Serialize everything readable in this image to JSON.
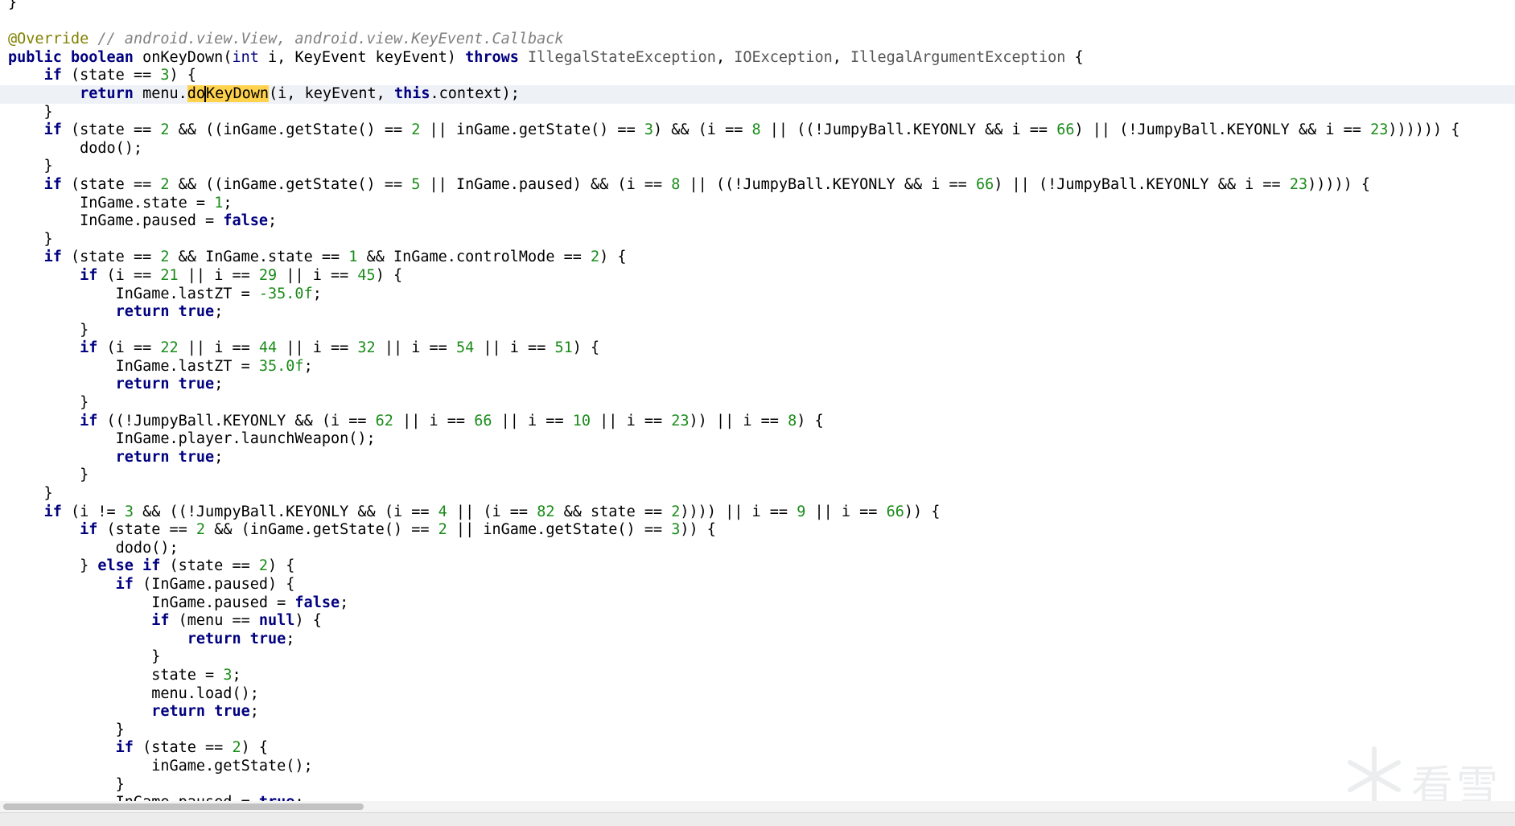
{
  "editor": {
    "language": "java",
    "cursor_line": 5,
    "highlighted_identifier": "doKeyDown",
    "watermark": "看雪",
    "lines": [
      [
        [
          "",
          "}"
        ]
      ],
      [],
      [
        [
          "ann",
          "@Override"
        ],
        [
          "cm",
          " // android.view.View, android.view.KeyEvent.Callback"
        ]
      ],
      [
        [
          "kw",
          "public"
        ],
        [
          "",
          " "
        ],
        [
          "kw",
          "boolean"
        ],
        [
          "",
          " onKeyDown("
        ],
        [
          "ty",
          "int"
        ],
        [
          "",
          " i, KeyEvent keyEvent) "
        ],
        [
          "kw",
          "throws"
        ],
        [
          "",
          " "
        ],
        [
          "exc",
          "IllegalStateException"
        ],
        [
          "",
          ", "
        ],
        [
          "exc",
          "IOException"
        ],
        [
          "",
          ", "
        ],
        [
          "exc",
          "IllegalArgumentException"
        ],
        [
          "",
          " {"
        ]
      ],
      [
        [
          "",
          "    "
        ],
        [
          "kw",
          "if"
        ],
        [
          "",
          " (state == "
        ],
        [
          "num",
          "3"
        ],
        [
          "",
          ") {"
        ]
      ],
      [
        [
          "",
          "        "
        ],
        [
          "kw",
          "return"
        ],
        [
          "",
          " menu."
        ],
        [
          "hl",
          "do"
        ],
        [
          "caret",
          ""
        ],
        [
          "hl",
          "KeyDown"
        ],
        [
          "",
          "(i, keyEvent, "
        ],
        [
          "kw",
          "this"
        ],
        [
          "",
          ".context);"
        ]
      ],
      [
        [
          "",
          "    }"
        ]
      ],
      [
        [
          "",
          "    "
        ],
        [
          "kw",
          "if"
        ],
        [
          "",
          " (state == "
        ],
        [
          "num",
          "2"
        ],
        [
          "",
          " && ((inGame.getState() == "
        ],
        [
          "num",
          "2"
        ],
        [
          "",
          " || inGame.getState() == "
        ],
        [
          "num",
          "3"
        ],
        [
          "",
          ") && (i == "
        ],
        [
          "num",
          "8"
        ],
        [
          "",
          " || ((!JumpyBall.KEYONLY && i == "
        ],
        [
          "num",
          "66"
        ],
        [
          "",
          ") || (!JumpyBall.KEYONLY && i == "
        ],
        [
          "num",
          "23"
        ],
        [
          "",
          ")))))) {"
        ]
      ],
      [
        [
          "",
          "        dodo();"
        ]
      ],
      [
        [
          "",
          "    }"
        ]
      ],
      [
        [
          "",
          "    "
        ],
        [
          "kw",
          "if"
        ],
        [
          "",
          " (state == "
        ],
        [
          "num",
          "2"
        ],
        [
          "",
          " && ((inGame.getState() == "
        ],
        [
          "num",
          "5"
        ],
        [
          "",
          " || InGame.paused) && (i == "
        ],
        [
          "num",
          "8"
        ],
        [
          "",
          " || ((!JumpyBall.KEYONLY && i == "
        ],
        [
          "num",
          "66"
        ],
        [
          "",
          ") || (!JumpyBall.KEYONLY && i == "
        ],
        [
          "num",
          "23"
        ],
        [
          "",
          "))))) {"
        ]
      ],
      [
        [
          "",
          "        InGame.state = "
        ],
        [
          "num",
          "1"
        ],
        [
          "",
          ";"
        ]
      ],
      [
        [
          "",
          "        InGame.paused = "
        ],
        [
          "kw",
          "false"
        ],
        [
          "",
          ";"
        ]
      ],
      [
        [
          "",
          "    }"
        ]
      ],
      [
        [
          "",
          "    "
        ],
        [
          "kw",
          "if"
        ],
        [
          "",
          " (state == "
        ],
        [
          "num",
          "2"
        ],
        [
          "",
          " && InGame.state == "
        ],
        [
          "num",
          "1"
        ],
        [
          "",
          " && InGame.controlMode == "
        ],
        [
          "num",
          "2"
        ],
        [
          "",
          ") {"
        ]
      ],
      [
        [
          "",
          "        "
        ],
        [
          "kw",
          "if"
        ],
        [
          "",
          " (i == "
        ],
        [
          "num",
          "21"
        ],
        [
          "",
          " || i == "
        ],
        [
          "num",
          "29"
        ],
        [
          "",
          " || i == "
        ],
        [
          "num",
          "45"
        ],
        [
          "",
          ") {"
        ]
      ],
      [
        [
          "",
          "            InGame.lastZT = "
        ],
        [
          "num",
          "-35.0f"
        ],
        [
          "",
          ";"
        ]
      ],
      [
        [
          "",
          "            "
        ],
        [
          "kw",
          "return"
        ],
        [
          "",
          " "
        ],
        [
          "kw",
          "true"
        ],
        [
          "",
          ";"
        ]
      ],
      [
        [
          "",
          "        }"
        ]
      ],
      [
        [
          "",
          "        "
        ],
        [
          "kw",
          "if"
        ],
        [
          "",
          " (i == "
        ],
        [
          "num",
          "22"
        ],
        [
          "",
          " || i == "
        ],
        [
          "num",
          "44"
        ],
        [
          "",
          " || i == "
        ],
        [
          "num",
          "32"
        ],
        [
          "",
          " || i == "
        ],
        [
          "num",
          "54"
        ],
        [
          "",
          " || i == "
        ],
        [
          "num",
          "51"
        ],
        [
          "",
          ") {"
        ]
      ],
      [
        [
          "",
          "            InGame.lastZT = "
        ],
        [
          "num",
          "35.0f"
        ],
        [
          "",
          ";"
        ]
      ],
      [
        [
          "",
          "            "
        ],
        [
          "kw",
          "return"
        ],
        [
          "",
          " "
        ],
        [
          "kw",
          "true"
        ],
        [
          "",
          ";"
        ]
      ],
      [
        [
          "",
          "        }"
        ]
      ],
      [
        [
          "",
          "        "
        ],
        [
          "kw",
          "if"
        ],
        [
          "",
          " ((!JumpyBall.KEYONLY && (i == "
        ],
        [
          "num",
          "62"
        ],
        [
          "",
          " || i == "
        ],
        [
          "num",
          "66"
        ],
        [
          "",
          " || i == "
        ],
        [
          "num",
          "10"
        ],
        [
          "",
          " || i == "
        ],
        [
          "num",
          "23"
        ],
        [
          "",
          ")) || i == "
        ],
        [
          "num",
          "8"
        ],
        [
          "",
          ") {"
        ]
      ],
      [
        [
          "",
          "            InGame.player.launchWeapon();"
        ]
      ],
      [
        [
          "",
          "            "
        ],
        [
          "kw",
          "return"
        ],
        [
          "",
          " "
        ],
        [
          "kw",
          "true"
        ],
        [
          "",
          ";"
        ]
      ],
      [
        [
          "",
          "        }"
        ]
      ],
      [
        [
          "",
          "    }"
        ]
      ],
      [
        [
          "",
          "    "
        ],
        [
          "kw",
          "if"
        ],
        [
          "",
          " (i != "
        ],
        [
          "num",
          "3"
        ],
        [
          "",
          " && ((!JumpyBall.KEYONLY && (i == "
        ],
        [
          "num",
          "4"
        ],
        [
          "",
          " || (i == "
        ],
        [
          "num",
          "82"
        ],
        [
          "",
          " && state == "
        ],
        [
          "num",
          "2"
        ],
        [
          "",
          ")))) || i == "
        ],
        [
          "num",
          "9"
        ],
        [
          "",
          " || i == "
        ],
        [
          "num",
          "66"
        ],
        [
          "",
          ")) {"
        ]
      ],
      [
        [
          "",
          "        "
        ],
        [
          "kw",
          "if"
        ],
        [
          "",
          " (state == "
        ],
        [
          "num",
          "2"
        ],
        [
          "",
          " && (inGame.getState() == "
        ],
        [
          "num",
          "2"
        ],
        [
          "",
          " || inGame.getState() == "
        ],
        [
          "num",
          "3"
        ],
        [
          "",
          ")) {"
        ]
      ],
      [
        [
          "",
          "            dodo();"
        ]
      ],
      [
        [
          "",
          "        } "
        ],
        [
          "kw",
          "else if"
        ],
        [
          "",
          " (state == "
        ],
        [
          "num",
          "2"
        ],
        [
          "",
          ") {"
        ]
      ],
      [
        [
          "",
          "            "
        ],
        [
          "kw",
          "if"
        ],
        [
          "",
          " (InGame.paused) {"
        ]
      ],
      [
        [
          "",
          "                InGame.paused = "
        ],
        [
          "kw",
          "false"
        ],
        [
          "",
          ";"
        ]
      ],
      [
        [
          "",
          "                "
        ],
        [
          "kw",
          "if"
        ],
        [
          "",
          " (menu == "
        ],
        [
          "kw",
          "null"
        ],
        [
          "",
          ") {"
        ]
      ],
      [
        [
          "",
          "                    "
        ],
        [
          "kw",
          "return"
        ],
        [
          "",
          " "
        ],
        [
          "kw",
          "true"
        ],
        [
          "",
          ";"
        ]
      ],
      [
        [
          "",
          "                }"
        ]
      ],
      [
        [
          "",
          "                state = "
        ],
        [
          "num",
          "3"
        ],
        [
          "",
          ";"
        ]
      ],
      [
        [
          "",
          "                menu.load();"
        ]
      ],
      [
        [
          "",
          "                "
        ],
        [
          "kw",
          "return"
        ],
        [
          "",
          " "
        ],
        [
          "kw",
          "true"
        ],
        [
          "",
          ";"
        ]
      ],
      [
        [
          "",
          "            }"
        ]
      ],
      [
        [
          "",
          "            "
        ],
        [
          "kw",
          "if"
        ],
        [
          "",
          " (state == "
        ],
        [
          "num",
          "2"
        ],
        [
          "",
          ") {"
        ]
      ],
      [
        [
          "",
          "                inGame.getState();"
        ]
      ],
      [
        [
          "",
          "            }"
        ]
      ],
      [
        [
          "",
          "            InGame.paused = "
        ],
        [
          "kw",
          "true"
        ],
        [
          "",
          ";"
        ]
      ]
    ]
  }
}
